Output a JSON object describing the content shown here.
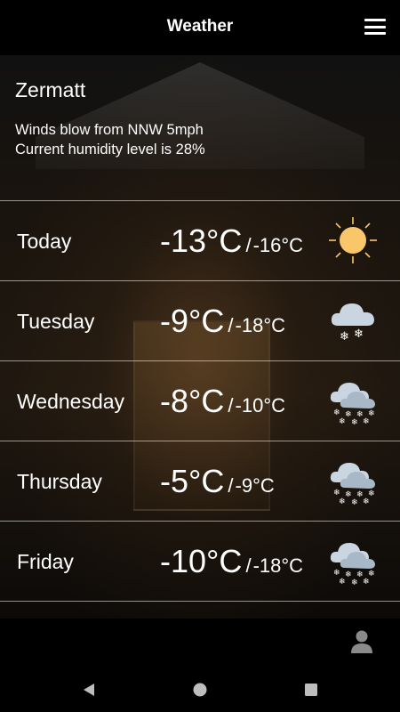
{
  "app": {
    "title": "Weather"
  },
  "location": {
    "city": "Zermatt",
    "wind": "Winds blow from NNW 5mph",
    "humidity": "Current humidity level is 28%"
  },
  "forecast": [
    {
      "day": "Today",
      "high": "-13°C",
      "low": "-16°C",
      "icon": "sun-icon"
    },
    {
      "day": "Tuesday",
      "high": "-9°C",
      "low": "-18°C",
      "icon": "snow-cloud-icon"
    },
    {
      "day": "Wednesday",
      "high": "-8°C",
      "low": "-10°C",
      "icon": "heavy-snow-cloud-icon"
    },
    {
      "day": "Thursday",
      "high": "-5°C",
      "low": "-9°C",
      "icon": "heavy-snow-cloud-icon"
    },
    {
      "day": "Friday",
      "high": "-10°C",
      "low": "-18°C",
      "icon": "heavy-snow-cloud-icon"
    }
  ],
  "separator": "/",
  "colors": {
    "sun": "#F9C66A",
    "cloud": "#C9D6E2",
    "snowflake": "#FFFFFF"
  }
}
